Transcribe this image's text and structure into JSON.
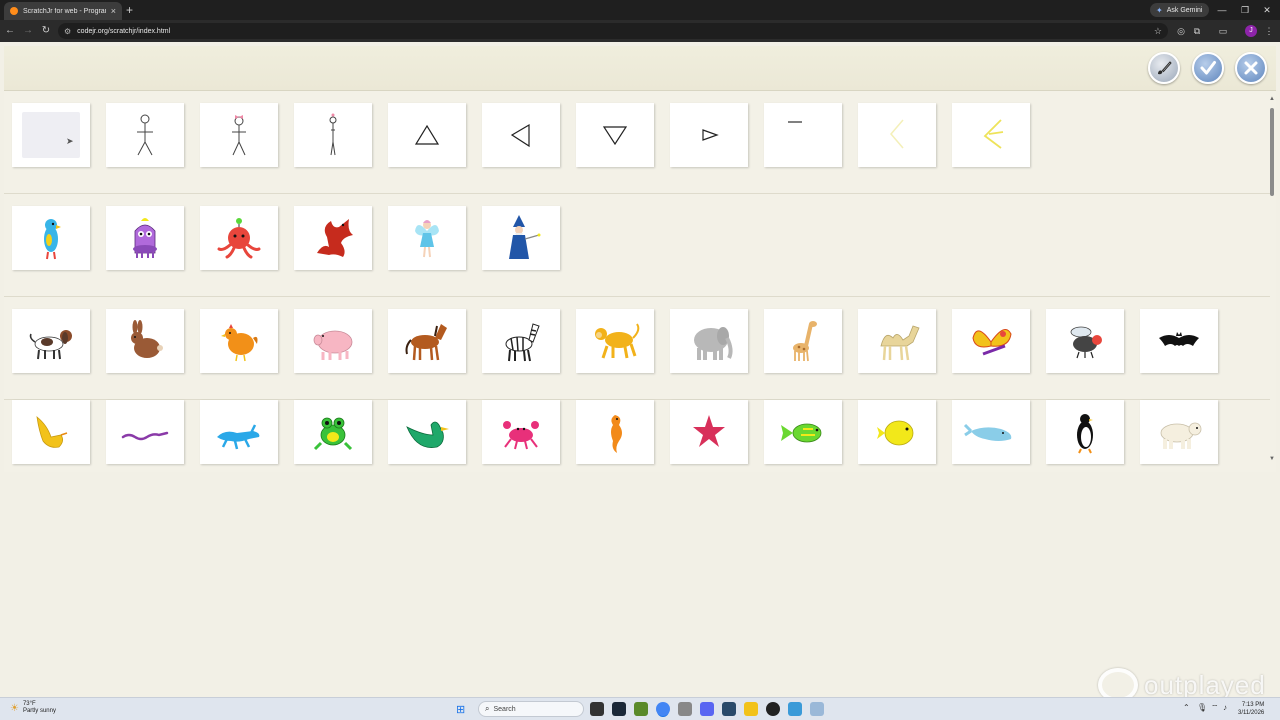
{
  "browser": {
    "tab_title": "ScratchJr for web - Program",
    "new_tab": "+",
    "ask_gemini": "Ask Gemini",
    "url": "codejr.org/scratchjr/index.html"
  },
  "library": {
    "rows": [
      {
        "items": [
          {
            "type": "blank"
          },
          {
            "type": "stick-figure"
          },
          {
            "type": "stick-figure-bow"
          },
          {
            "type": "stick-figure-side"
          },
          {
            "type": "triangle-up"
          },
          {
            "type": "triangle-left"
          },
          {
            "type": "triangle-down"
          },
          {
            "type": "triangle-right"
          },
          {
            "type": "line"
          },
          {
            "type": "yellow-chevron-faint"
          },
          {
            "type": "yellow-chevron"
          }
        ]
      },
      {
        "items": [
          {
            "type": "blue-bird",
            "color": "#38b5e8"
          },
          {
            "type": "purple-monster",
            "color": "#b06adb"
          },
          {
            "type": "red-octopus",
            "color": "#e8463c"
          },
          {
            "type": "red-dragon",
            "color": "#c62b1d"
          },
          {
            "type": "fairy",
            "color": "#5fc4e8"
          },
          {
            "type": "wizard",
            "color": "#2256a8"
          }
        ]
      },
      {
        "items": [
          {
            "type": "dog",
            "color": "#8a4b2a"
          },
          {
            "type": "rabbit",
            "color": "#9a5a36"
          },
          {
            "type": "chicken",
            "color": "#f29018"
          },
          {
            "type": "pig",
            "color": "#f7b6c3"
          },
          {
            "type": "horse",
            "color": "#b35a1f"
          },
          {
            "type": "zebra",
            "color": "#222222"
          },
          {
            "type": "monkey",
            "color": "#f2b21a"
          },
          {
            "type": "elephant",
            "color": "#b8b8b8"
          },
          {
            "type": "giraffe",
            "color": "#e8b36a"
          },
          {
            "type": "camel",
            "color": "#e8d59a"
          },
          {
            "type": "butterfly",
            "color": "#f2c21a"
          },
          {
            "type": "fly",
            "color": "#555555"
          },
          {
            "type": "bat",
            "color": "#111111"
          }
        ]
      },
      {
        "items": [
          {
            "type": "yellow-bird",
            "color": "#f2c21a"
          },
          {
            "type": "snake",
            "color": "#8a3aa8"
          },
          {
            "type": "lizard",
            "color": "#2aa8e8"
          },
          {
            "type": "frog",
            "color": "#3ac23a"
          },
          {
            "type": "duck",
            "color": "#1fa86a"
          },
          {
            "type": "crab",
            "color": "#e8307a"
          },
          {
            "type": "seahorse",
            "color": "#f28a1a"
          },
          {
            "type": "starfish",
            "color": "#d8305a"
          },
          {
            "type": "green-fish",
            "color": "#6ad830"
          },
          {
            "type": "yellow-fish",
            "color": "#f2e81a"
          },
          {
            "type": "whale",
            "color": "#8acde8"
          },
          {
            "type": "penguin",
            "color": "#111111"
          },
          {
            "type": "polar-bear",
            "color": "#f5efdf"
          }
        ]
      }
    ]
  },
  "watermark": "outplayed",
  "taskbar": {
    "temp": "73°F",
    "weather": "Partly sunny",
    "search_placeholder": "Search",
    "time": "7:13 PM",
    "date": "3/11/2026"
  }
}
